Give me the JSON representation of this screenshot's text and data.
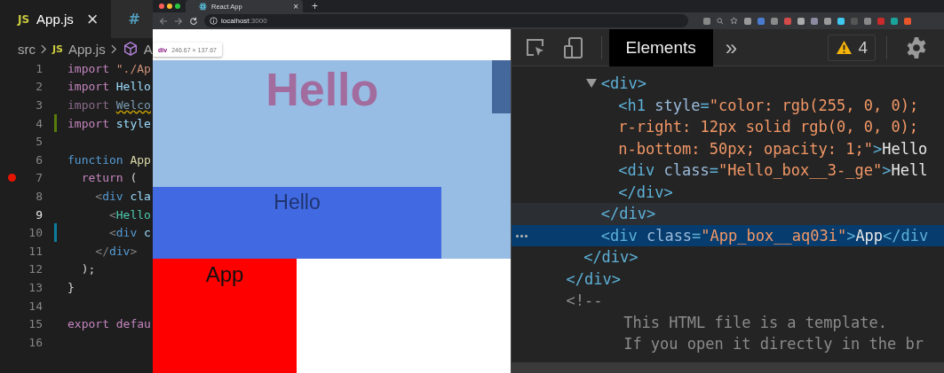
{
  "editor": {
    "tabs": [
      {
        "icon": "JS",
        "label": "App.js",
        "close": "×",
        "selected": true
      },
      {
        "icon": "#",
        "selected": false
      }
    ],
    "breadcrumb": [
      {
        "kind": "folder",
        "label": "src"
      },
      {
        "kind": "file",
        "icon": "JS",
        "label": "App.js"
      },
      {
        "kind": "symbol",
        "label": "A"
      }
    ],
    "lines": [
      {
        "n": "1",
        "kind": "plain",
        "breakpoint": false,
        "current": false,
        "tokens": [
          {
            "kind": "kw",
            "text": "import "
          },
          {
            "kind": "str",
            "text": "\"./Ap"
          }
        ]
      },
      {
        "n": "2",
        "kind": "plain",
        "breakpoint": false,
        "current": false,
        "tokens": [
          {
            "kind": "kw",
            "text": "import "
          },
          {
            "kind": "id",
            "text": "Hello"
          }
        ]
      },
      {
        "n": "3",
        "kind": "plain",
        "breakpoint": false,
        "current": false,
        "tokens": [
          {
            "kind": "dim",
            "text": "import "
          },
          {
            "kind": "warn",
            "text": "Welco"
          }
        ]
      },
      {
        "n": "4",
        "kind": "added",
        "breakpoint": false,
        "current": false,
        "tokens": [
          {
            "kind": "kw",
            "text": "import "
          },
          {
            "kind": "id",
            "text": "style"
          }
        ]
      },
      {
        "n": "5",
        "kind": "plain",
        "breakpoint": false,
        "current": false
      },
      {
        "n": "6",
        "kind": "plain",
        "breakpoint": false,
        "current": false,
        "tokens": [
          {
            "kind": "decl",
            "text": "function "
          },
          {
            "kind": "fn",
            "text": "App"
          }
        ]
      },
      {
        "n": "7",
        "kind": "plain",
        "breakpoint": true,
        "current": false,
        "tokens": [
          {
            "kind": "kw",
            "text": "  return "
          },
          {
            "kind": "punc",
            "text": "("
          }
        ]
      },
      {
        "n": "8",
        "kind": "plain",
        "breakpoint": false,
        "current": false,
        "tokens": [
          {
            "kind": "br",
            "text": "    <"
          },
          {
            "kind": "decl",
            "text": "div "
          },
          {
            "kind": "id",
            "text": "cla"
          }
        ]
      },
      {
        "n": "9",
        "kind": "plain",
        "breakpoint": false,
        "current": true,
        "tokens": [
          {
            "kind": "br",
            "text": "      <"
          },
          {
            "kind": "jsx",
            "text": "Hello"
          }
        ]
      },
      {
        "n": "10",
        "kind": "modified",
        "breakpoint": false,
        "current": false,
        "tokens": [
          {
            "kind": "br",
            "text": "      <"
          },
          {
            "kind": "decl",
            "text": "div "
          },
          {
            "kind": "id",
            "text": "c"
          }
        ]
      },
      {
        "n": "11",
        "kind": "plain",
        "breakpoint": false,
        "current": false,
        "tokens": [
          {
            "kind": "br",
            "text": "    </"
          },
          {
            "kind": "decl",
            "text": "div"
          },
          {
            "kind": "br",
            "text": ">"
          }
        ]
      },
      {
        "n": "12",
        "kind": "plain",
        "breakpoint": false,
        "current": false,
        "tokens": [
          {
            "kind": "punc",
            "text": "  );"
          }
        ]
      },
      {
        "n": "13",
        "kind": "plain",
        "breakpoint": false,
        "current": false,
        "tokens": [
          {
            "kind": "punc",
            "text": "}"
          }
        ]
      },
      {
        "n": "14",
        "kind": "plain",
        "breakpoint": false,
        "current": false
      },
      {
        "n": "15",
        "kind": "plain",
        "breakpoint": false,
        "current": false,
        "tokens": [
          {
            "kind": "kw",
            "text": "export "
          },
          {
            "kind": "kw",
            "text": "defau"
          }
        ]
      },
      {
        "n": "16",
        "kind": "plain",
        "breakpoint": false,
        "current": false
      }
    ]
  },
  "browser": {
    "tab": {
      "title": "React App",
      "close": "×"
    },
    "new_tab": "+",
    "address": {
      "host": "localhost",
      "port": ":3000"
    },
    "page": {
      "tooltip": {
        "tag": "div",
        "size": "246.67 × 137.67"
      },
      "heading": "Hello",
      "hello_box": "Hello",
      "app_box": "App"
    }
  },
  "devtools": {
    "tabs": [
      {
        "label": "Elements",
        "selected": true
      }
    ],
    "more": "»",
    "warnings": "4",
    "dom": [
      {
        "close": [
          {
            "tokens": [
              {
                "kind": "tag",
                "text": "</div>"
              }
            ]
          }
        ],
        "children": [
          {
            "close": [
              {
                "tokens": [
                  {
                    "kind": "tag",
                    "text": "</div>"
                  }
                ]
              }
            ],
            "children": [
              {
                "rows": [
                  {
                    "tokens": [
                      {
                        "kind": "tag",
                        "text": "<div>"
                      }
                    ]
                  }
                ],
                "expanded": true,
                "hovered": true,
                "close": [
                  {
                    "tokens": [
                      {
                        "kind": "tag",
                        "text": "</div>"
                      }
                    ]
                  }
                ],
                "children": [
                  {
                    "rows": [
                      {
                        "tokens": [
                          {
                            "kind": "tag",
                            "text": "<h1 "
                          },
                          {
                            "kind": "attr",
                            "text": "style"
                          },
                          {
                            "kind": "tag",
                            "text": "="
                          },
                          {
                            "kind": "val",
                            "text": "\"color: rgb(255, 0, 0);"
                          }
                        ]
                      },
                      {
                        "tokens": [
                          {
                            "kind": "val",
                            "text": "r-right: 12px solid rgb(0, 0, 0);"
                          }
                        ]
                      },
                      {
                        "tokens": [
                          {
                            "kind": "val",
                            "text": "n-bottom: 50px; opacity: 1;\""
                          },
                          {
                            "kind": "tag",
                            "text": ">"
                          },
                          {
                            "kind": "text",
                            "text": "Hello"
                          }
                        ]
                      }
                    ]
                  },
                  {
                    "rows": [
                      {
                        "tokens": [
                          {
                            "kind": "tag",
                            "text": "<div "
                          },
                          {
                            "kind": "attr",
                            "text": "class"
                          },
                          {
                            "kind": "tag",
                            "text": "="
                          },
                          {
                            "kind": "val",
                            "text": "\"Hello_box__3-_ge\""
                          },
                          {
                            "kind": "tag",
                            "text": ">"
                          },
                          {
                            "kind": "text",
                            "text": "Hell"
                          }
                        ]
                      }
                    ],
                    "close": [
                      {
                        "tokens": [
                          {
                            "kind": "tag",
                            "text": "</div>"
                          }
                        ]
                      }
                    ]
                  }
                ]
              },
              {
                "rows": [
                  {
                    "tokens": [
                      {
                        "kind": "tag",
                        "text": "<div "
                      },
                      {
                        "kind": "attr",
                        "text": "class"
                      },
                      {
                        "kind": "tag",
                        "text": "="
                      },
                      {
                        "kind": "val",
                        "text": "\"App_box__aq03i\""
                      },
                      {
                        "kind": "tag",
                        "text": ">"
                      },
                      {
                        "kind": "text",
                        "text": "App"
                      },
                      {
                        "kind": "tag",
                        "text": "</div"
                      }
                    ]
                  }
                ],
                "selected": true
              }
            ]
          }
        ]
      },
      {
        "rows": [
          {
            "tokens": [
              {
                "kind": "com",
                "text": "<!--"
              }
            ]
          }
        ],
        "children": [
          {
            "rows": [
              {
                "tokens": [
                  {
                    "kind": "ctext",
                    "text": "This HTML file is a template."
                  }
                ]
              },
              {
                "tokens": [
                  {
                    "kind": "ctext",
                    "text": "If you open it directly in the br"
                  }
                ]
              }
            ]
          }
        ]
      }
    ]
  }
}
